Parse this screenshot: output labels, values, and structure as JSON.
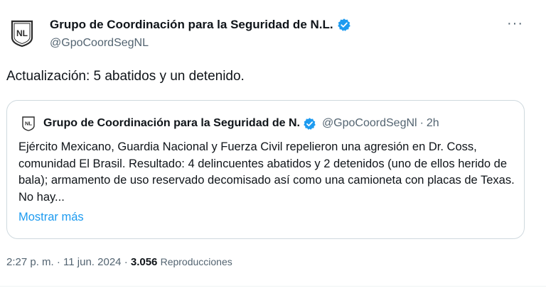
{
  "author": {
    "display_name": "Grupo de Coordinación para la Seguridad de N.L.",
    "handle": "@GpoCoordSegNL",
    "avatar_text": "NL"
  },
  "more_label": "···",
  "tweet": {
    "text": "Actualización: 5 abatidos y un detenido."
  },
  "quoted": {
    "display_name": "Grupo de Coordinación para la Seguridad de N.",
    "handle": "@GpoCoordSegNl",
    "separator": "·",
    "time": "2h",
    "body": "Ejército Mexicano, Guardia Nacional y Fuerza Civil repelieron una agresión en Dr. Coss, comunidad El Brasil. Resultado: 4 delincuentes abatidos y 2 detenidos (uno de ellos herido de bala); armamento de uso reservado decomisado así como una camioneta con placas de Texas. No hay...",
    "show_more": "Mostrar más"
  },
  "meta": {
    "time": "2:27 p. m.",
    "sep1": "·",
    "date": "11 jun. 2024",
    "sep2": "·",
    "views_count": "3.056",
    "views_label": "Reproducciones"
  },
  "colors": {
    "text": "#0f1419",
    "secondary": "#536471",
    "link": "#1d9bf0",
    "border": "#cfd9de"
  }
}
